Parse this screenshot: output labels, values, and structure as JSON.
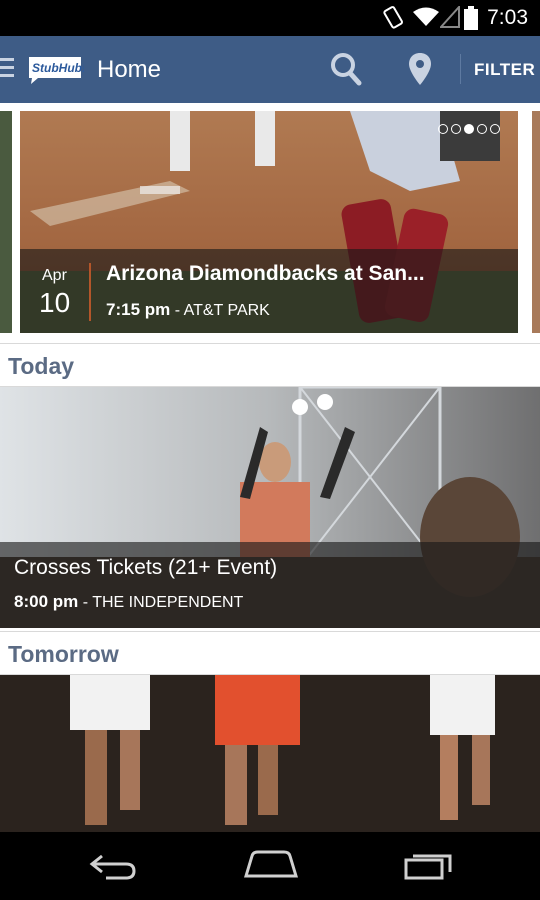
{
  "status_bar": {
    "time": "7:03"
  },
  "app_bar": {
    "title": "Home",
    "logo_text": "StubHub!",
    "filter_label": "FILTER"
  },
  "featured": {
    "month": "Apr",
    "day": "10",
    "title": "Arizona Diamondbacks at San...",
    "time": "7:15 pm",
    "venue": "- AT&T PARK",
    "carousel_pages": 5,
    "carousel_active": 3
  },
  "sections": [
    {
      "header": "Today",
      "event": {
        "title": "Crosses Tickets (21+ Event)",
        "time": "8:00 pm",
        "venue": "- THE INDEPENDENT"
      }
    },
    {
      "header": "Tomorrow"
    }
  ],
  "colors": {
    "app_bar": "#3e5c86",
    "section_header_text": "#5b6b84",
    "date_accent": "#b3562a"
  }
}
